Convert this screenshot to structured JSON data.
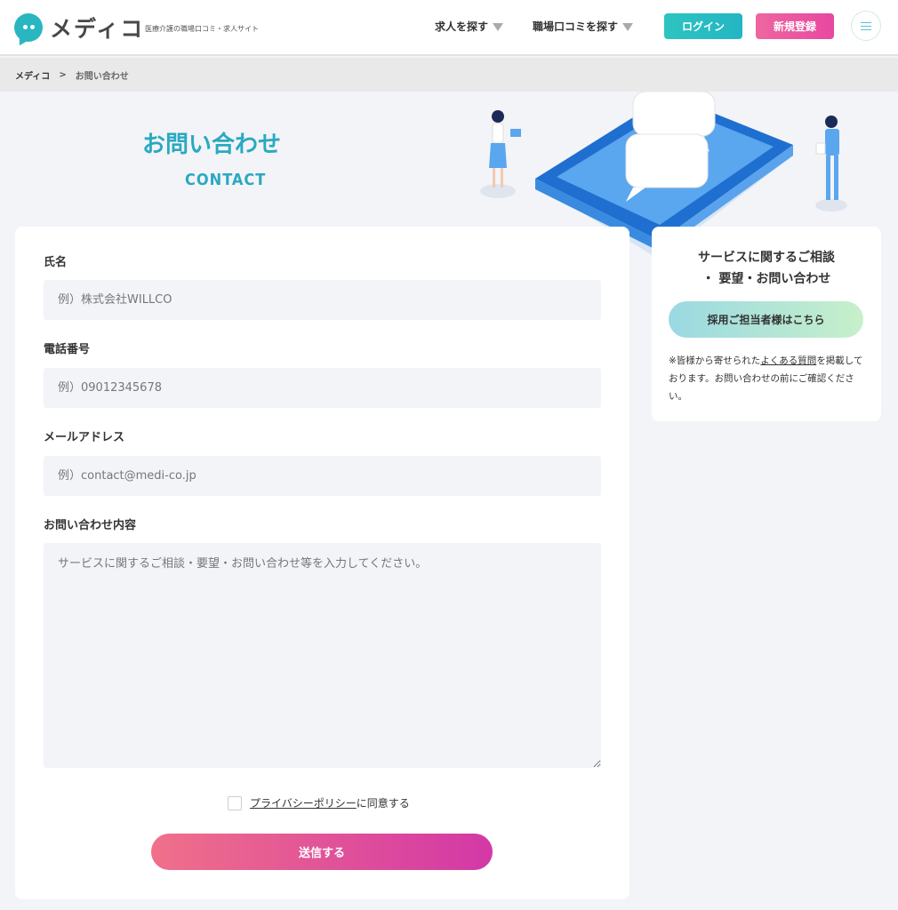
{
  "header": {
    "logo_text": "メディコ",
    "tagline": "医療介護の職場口コミ・求人サイト",
    "nav": [
      {
        "label": "求人を探す"
      },
      {
        "label": "職場口コミを探す"
      }
    ],
    "login_label": "ログイン",
    "register_label": "新規登録"
  },
  "breadcrumb": {
    "home": "メディコ",
    "separator": ">",
    "current": "お問い合わせ"
  },
  "hero": {
    "title": "お問い合わせ",
    "subtitle": "CONTACT"
  },
  "form": {
    "fields": [
      {
        "label": "氏名",
        "placeholder": "例）株式会社WILLCO"
      },
      {
        "label": "電話番号",
        "placeholder": "例）09012345678"
      },
      {
        "label": "メールアドレス",
        "placeholder": "例）contact@medi-co.jp"
      },
      {
        "label": "お問い合わせ内容",
        "placeholder": "サービスに関するご相談・要望・お問い合わせ等を入力してください。"
      }
    ],
    "privacy_link": "プライバシーポリシー",
    "privacy_suffix": "に同意する",
    "submit_label": "送信する"
  },
  "side": {
    "title_line1": "サービスに関するご相談",
    "title_line2": "・ 要望・お問い合わせ",
    "employer_button": "採用ご担当者様はこちら",
    "note_prefix": "※皆様から寄せられた",
    "note_link": "よくある質問",
    "note_suffix": "を掲載しております。お問い合わせの前にご確認ください。"
  },
  "colors": {
    "accent_teal": "#2aa9c1",
    "accent_pink": "#e848a0",
    "background": "#f3f4f8"
  }
}
